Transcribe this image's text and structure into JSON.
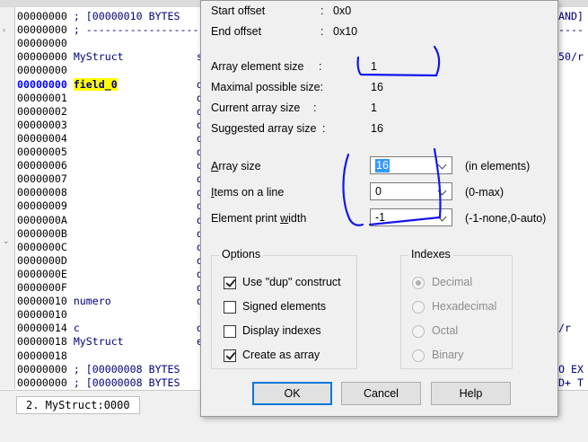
{
  "listing": {
    "lines": [
      {
        "addr": "00000000",
        "text": " ; [00000010 BYTES"
      },
      {
        "addr": "00000000",
        "text": " ; -------------------"
      },
      {
        "addr": "00000000",
        "text": ""
      },
      {
        "addr": "00000000",
        "text": " MyStruct",
        "col2": "s"
      },
      {
        "addr": "00000000",
        "text": ""
      },
      {
        "addr": "00000000",
        "name": "field_0",
        "col2": "d",
        "current": true
      },
      {
        "addr": "00000001",
        "text": "",
        "col2": "d"
      },
      {
        "addr": "00000002",
        "text": "",
        "col2": "d"
      },
      {
        "addr": "00000003",
        "text": "",
        "col2": "d"
      },
      {
        "addr": "00000004",
        "text": "",
        "col2": "d"
      },
      {
        "addr": "00000005",
        "text": "",
        "col2": "d"
      },
      {
        "addr": "00000006",
        "text": "",
        "col2": "d"
      },
      {
        "addr": "00000007",
        "text": "",
        "col2": "d"
      },
      {
        "addr": "00000008",
        "text": "",
        "col2": "d"
      },
      {
        "addr": "00000009",
        "text": "",
        "col2": "d"
      },
      {
        "addr": "0000000A",
        "text": "",
        "col2": "d"
      },
      {
        "addr": "0000000B",
        "text": "",
        "col2": "d"
      },
      {
        "addr": "0000000C",
        "text": "",
        "col2": "d"
      },
      {
        "addr": "0000000D",
        "text": "",
        "col2": "d"
      },
      {
        "addr": "0000000E",
        "text": "",
        "col2": "d"
      },
      {
        "addr": "0000000F",
        "text": "",
        "col2": "d"
      },
      {
        "addr": "00000010",
        "text": " numero",
        "col2": "d"
      },
      {
        "addr": "00000010",
        "text": ""
      },
      {
        "addr": "00000014",
        "text": " c",
        "col2": "d"
      },
      {
        "addr": "00000018",
        "text": " MyStruct",
        "col2": "e"
      },
      {
        "addr": "00000018",
        "text": ""
      },
      {
        "addr": "00000000",
        "text": " ; [00000008 BYTES"
      },
      {
        "addr": "00000000",
        "text": " ; [00000008 BYTES"
      }
    ],
    "right_fragments": [
      {
        "row": 0,
        "text": "AND]"
      },
      {
        "row": 1,
        "text": "----"
      },
      {
        "row": 3,
        "text": "50/r"
      },
      {
        "row": 23,
        "text": "/r"
      },
      {
        "row": 26,
        "text": "O EX"
      },
      {
        "row": 27,
        "text": "D+ T"
      }
    ]
  },
  "status": {
    "tab": "2. MyStruct:0000"
  },
  "dialog": {
    "start_offset_label": "Start offset",
    "start_offset_colon": ":",
    "start_offset_value": "0x0",
    "end_offset_label": "End offset",
    "end_offset_colon": ":",
    "end_offset_value": "0x10",
    "array_element_size_label": "Array element size",
    "array_element_size_colon": ":",
    "array_element_size_value": "1",
    "max_size_label": "Maximal possible size:",
    "max_size_value": "16",
    "current_size_label": "Current array size",
    "current_size_colon": ":",
    "current_size_value": "1",
    "suggested_size_label": "Suggested array size",
    "suggested_size_colon": ":",
    "suggested_size_value": "16",
    "array_size": {
      "label_hot": "A",
      "label_rest": "rray size",
      "value": "16",
      "hint": "(in elements)"
    },
    "items_on_line": {
      "label_hot": "I",
      "label_rest": "tems on a line",
      "value": "0",
      "hint": "(0-max)"
    },
    "element_print_width": {
      "label_pre": "Element print ",
      "label_hot": "w",
      "label_rest": "idth",
      "value": "-1",
      "hint": "(-1-none,0-auto)"
    },
    "options": {
      "title": "Options",
      "items": [
        {
          "label": "Use \"dup\" construct",
          "checked": true
        },
        {
          "label": "Signed elements",
          "checked": false
        },
        {
          "label": "Display indexes",
          "checked": false
        },
        {
          "label": "Create as array",
          "checked": true
        }
      ]
    },
    "indexes": {
      "title": "Indexes",
      "items": [
        {
          "label": "Decimal",
          "selected": true
        },
        {
          "label": "Hexadecimal",
          "selected": false
        },
        {
          "label": "Octal",
          "selected": false
        },
        {
          "label": "Binary",
          "selected": false
        }
      ]
    },
    "buttons": {
      "ok": "OK",
      "cancel": "Cancel",
      "help": "Help"
    }
  },
  "colors": {
    "ink": "#1515ee",
    "highlight": "#ffff00",
    "accent": "#0078d7"
  }
}
